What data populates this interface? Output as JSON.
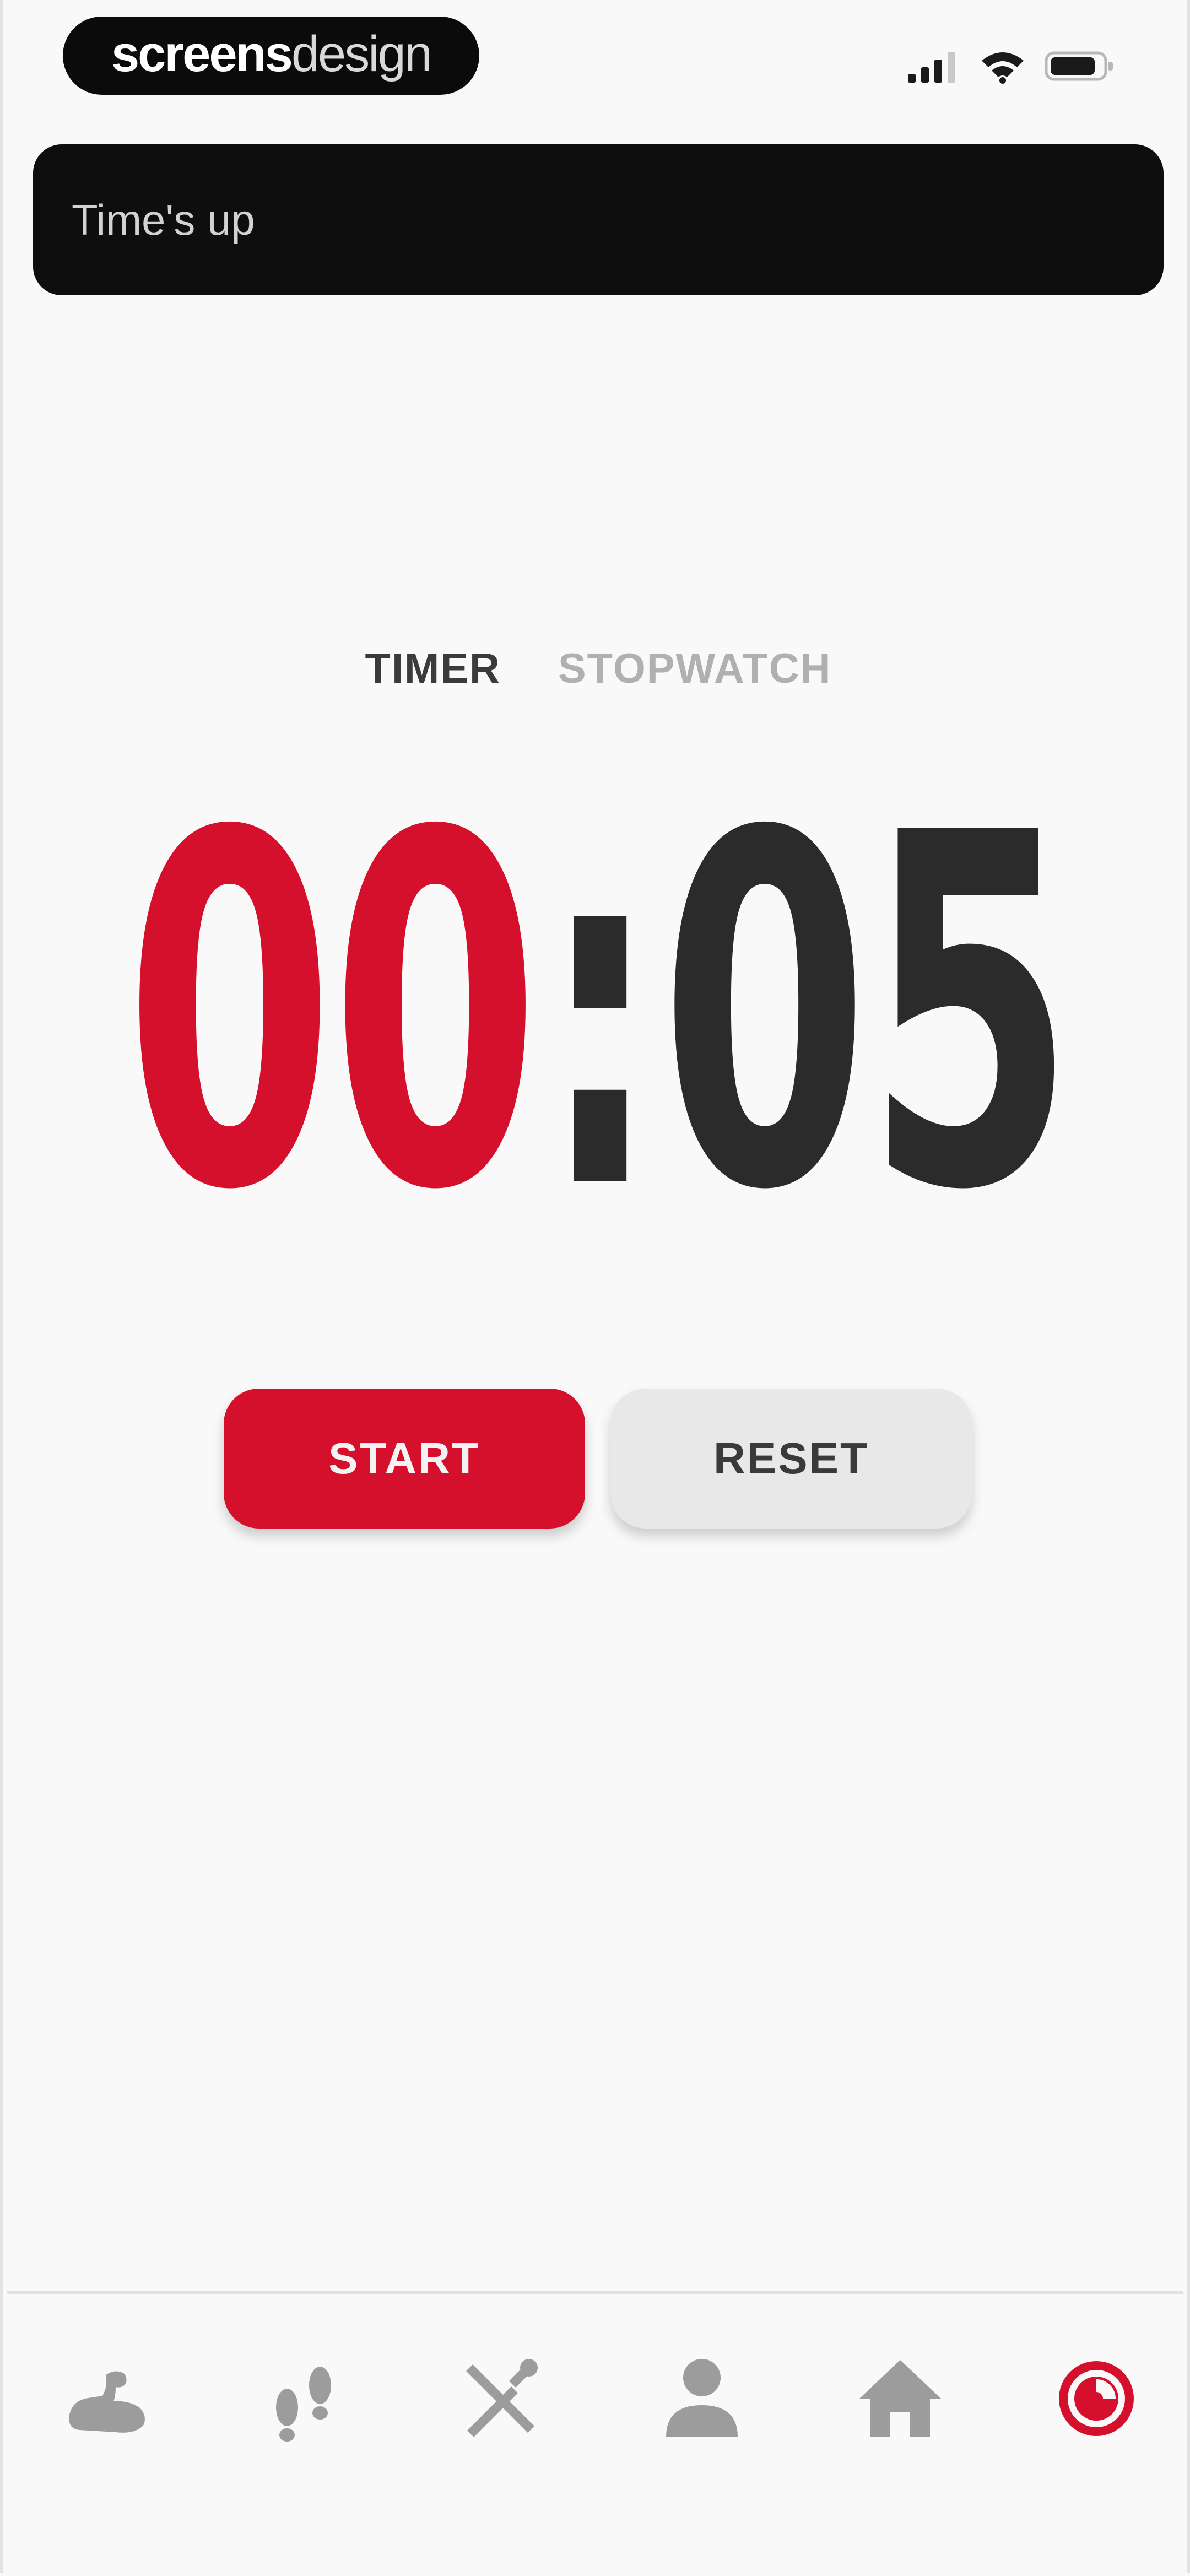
{
  "status_bar": {
    "brand_part_1": "screens",
    "brand_part_2": "design",
    "icons": [
      "signal-icon",
      "wifi-icon",
      "battery-icon"
    ]
  },
  "notification": {
    "text": "Time's up"
  },
  "tabs": [
    {
      "label": "TIMER",
      "active": true
    },
    {
      "label": "STOPWATCH",
      "active": false
    }
  ],
  "timer": {
    "minutes": "00",
    "separator": ":",
    "seconds": "05"
  },
  "buttons": {
    "start_label": "START",
    "reset_label": "RESET"
  },
  "bottom_nav": {
    "items": [
      {
        "icon": "flexed-arm-icon",
        "active": false
      },
      {
        "icon": "footsteps-icon",
        "active": false
      },
      {
        "icon": "fork-knife-icon",
        "active": false
      },
      {
        "icon": "person-icon",
        "active": false
      },
      {
        "icon": "home-icon",
        "active": false
      },
      {
        "icon": "timer-icon",
        "active": true
      }
    ]
  },
  "colors": {
    "accent": "#d5102d",
    "text_dark": "#2b2b2b",
    "inactive": "#9c9c9c",
    "banner_bg": "#0e0e0e",
    "background": "#f9f9f9"
  }
}
